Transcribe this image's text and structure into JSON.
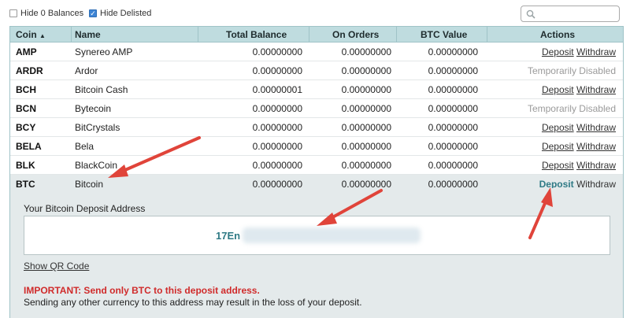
{
  "filters": {
    "hide_zero_label": "Hide 0 Balances",
    "hide_zero_checked": false,
    "hide_delisted_label": "Hide Delisted",
    "hide_delisted_checked": true,
    "search_placeholder": ""
  },
  "table": {
    "headers": {
      "coin": "Coin",
      "coin_sort": "▲",
      "name": "Name",
      "total_balance": "Total Balance",
      "on_orders": "On Orders",
      "btc_value": "BTC Value",
      "actions": "Actions"
    },
    "rows": [
      {
        "coin": "AMP",
        "name": "Synereo AMP",
        "total": "0.00000000",
        "orders": "0.00000000",
        "btc": "0.00000000",
        "deposit": "Deposit",
        "withdraw": "Withdraw",
        "disabled": ""
      },
      {
        "coin": "ARDR",
        "name": "Ardor",
        "total": "0.00000000",
        "orders": "0.00000000",
        "btc": "0.00000000",
        "deposit": "",
        "withdraw": "",
        "disabled": "Temporarily Disabled"
      },
      {
        "coin": "BCH",
        "name": "Bitcoin Cash",
        "total": "0.00000001",
        "orders": "0.00000000",
        "btc": "0.00000000",
        "deposit": "Deposit",
        "withdraw": "Withdraw",
        "disabled": ""
      },
      {
        "coin": "BCN",
        "name": "Bytecoin",
        "total": "0.00000000",
        "orders": "0.00000000",
        "btc": "0.00000000",
        "deposit": "",
        "withdraw": "",
        "disabled": "Temporarily Disabled"
      },
      {
        "coin": "BCY",
        "name": "BitCrystals",
        "total": "0.00000000",
        "orders": "0.00000000",
        "btc": "0.00000000",
        "deposit": "Deposit",
        "withdraw": "Withdraw",
        "disabled": ""
      },
      {
        "coin": "BELA",
        "name": "Bela",
        "total": "0.00000000",
        "orders": "0.00000000",
        "btc": "0.00000000",
        "deposit": "Deposit",
        "withdraw": "Withdraw",
        "disabled": ""
      },
      {
        "coin": "BLK",
        "name": "BlackCoin",
        "total": "0.00000000",
        "orders": "0.00000000",
        "btc": "0.00000000",
        "deposit": "Deposit",
        "withdraw": "Withdraw",
        "disabled": ""
      },
      {
        "coin": "BTC",
        "name": "Bitcoin",
        "total": "0.00000000",
        "orders": "0.00000000",
        "btc": "0.00000000",
        "deposit": "Deposit",
        "withdraw": "Withdraw",
        "disabled": ""
      }
    ]
  },
  "deposit_panel": {
    "label": "Your Bitcoin Deposit Address",
    "address_visible": "17En",
    "show_qr": "Show QR Code",
    "important": "IMPORTANT: Send only BTC to this deposit address.",
    "note": "Sending any other currency to this address may result in the loss of your deposit."
  },
  "colors": {
    "accent": "#2f7a85",
    "header_bg": "#bfdcdf",
    "warning": "#d02b2b",
    "annotation": "#e0443a"
  }
}
